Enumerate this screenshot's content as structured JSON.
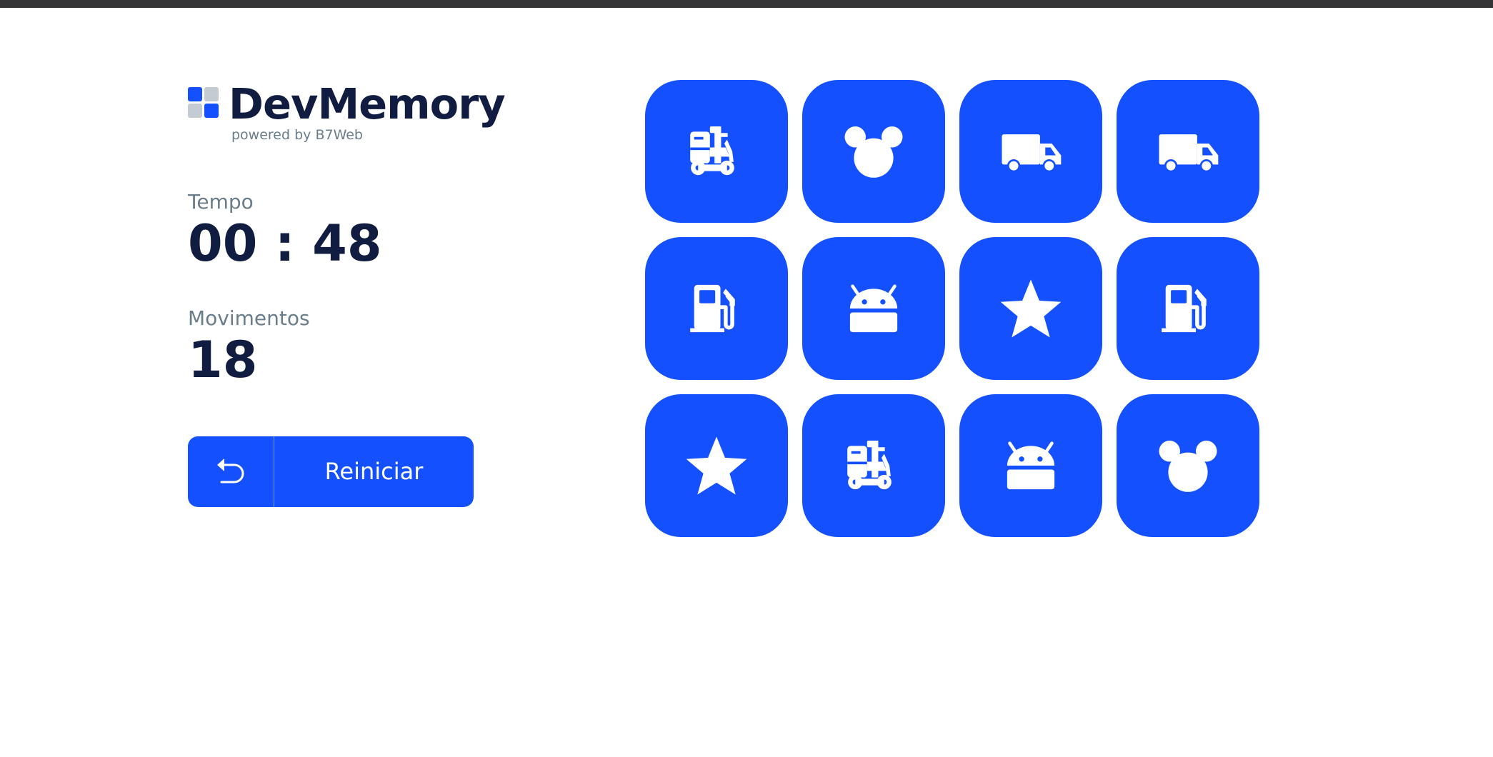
{
  "app": {
    "title": "DevMemory",
    "subtitle": "powered by B7Web"
  },
  "colors": {
    "primary": "#1550FF",
    "text_dark": "#101C40",
    "text_muted": "#6A7D8B",
    "logo_gray": "#C5CBD3"
  },
  "stats": {
    "time_label": "Tempo",
    "time_value": "00 : 48",
    "moves_label": "Movimentos",
    "moves_value": "18"
  },
  "restart": {
    "icon": "undo-icon",
    "label": "Reiniciar"
  },
  "cards": [
    {
      "icon": "forklift-icon"
    },
    {
      "icon": "mouse-ears-icon"
    },
    {
      "icon": "truck-icon"
    },
    {
      "icon": "truck-icon"
    },
    {
      "icon": "fuel-pump-icon"
    },
    {
      "icon": "android-icon"
    },
    {
      "icon": "star-icon"
    },
    {
      "icon": "fuel-pump-icon"
    },
    {
      "icon": "star-icon"
    },
    {
      "icon": "forklift-icon"
    },
    {
      "icon": "android-icon"
    },
    {
      "icon": "mouse-ears-icon"
    }
  ]
}
